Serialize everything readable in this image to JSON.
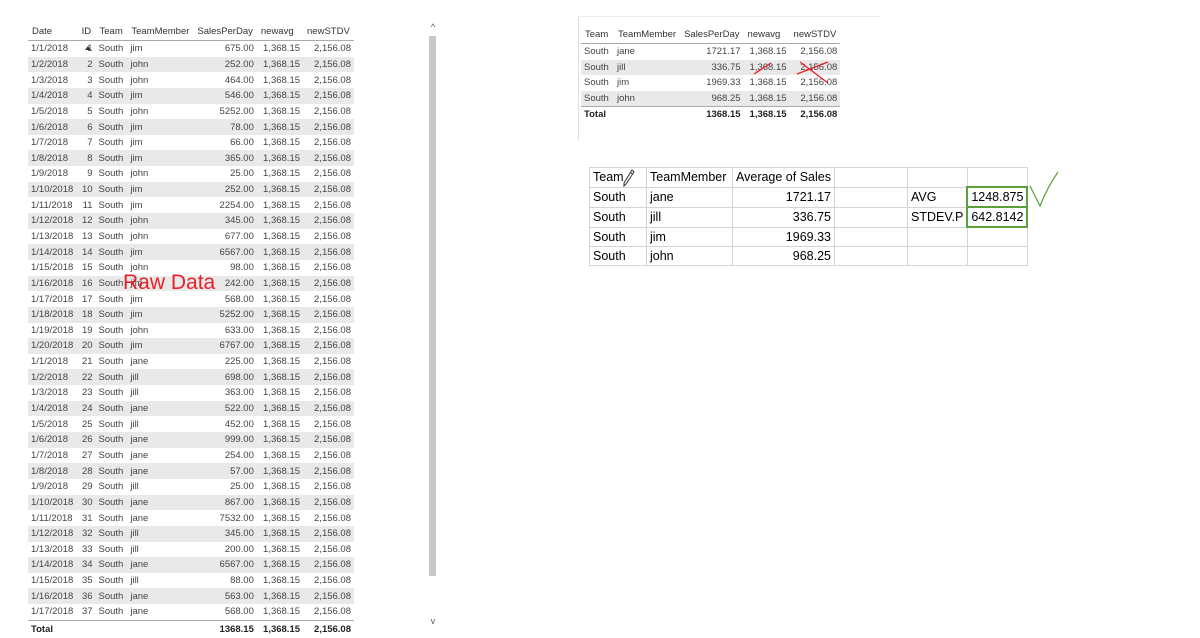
{
  "raw_table": {
    "headers": [
      "Date",
      "ID",
      "Team",
      "TeamMember",
      "SalesPerDay",
      "newavg",
      "newSTDV"
    ],
    "rows": [
      [
        "1/1/2018",
        "1",
        "South",
        "jim",
        "675.00",
        "1,368.15",
        "2,156.08"
      ],
      [
        "1/2/2018",
        "2",
        "South",
        "john",
        "252.00",
        "1,368.15",
        "2,156.08"
      ],
      [
        "1/3/2018",
        "3",
        "South",
        "john",
        "464.00",
        "1,368.15",
        "2,156.08"
      ],
      [
        "1/4/2018",
        "4",
        "South",
        "jim",
        "546.00",
        "1,368.15",
        "2,156.08"
      ],
      [
        "1/5/2018",
        "5",
        "South",
        "john",
        "5252.00",
        "1,368.15",
        "2,156.08"
      ],
      [
        "1/6/2018",
        "6",
        "South",
        "jim",
        "78.00",
        "1,368.15",
        "2,156.08"
      ],
      [
        "1/7/2018",
        "7",
        "South",
        "jim",
        "66.00",
        "1,368.15",
        "2,156.08"
      ],
      [
        "1/8/2018",
        "8",
        "South",
        "jim",
        "365.00",
        "1,368.15",
        "2,156.08"
      ],
      [
        "1/9/2018",
        "9",
        "South",
        "john",
        "25.00",
        "1,368.15",
        "2,156.08"
      ],
      [
        "1/10/2018",
        "10",
        "South",
        "jim",
        "252.00",
        "1,368.15",
        "2,156.08"
      ],
      [
        "1/11/2018",
        "11",
        "South",
        "jim",
        "2254.00",
        "1,368.15",
        "2,156.08"
      ],
      [
        "1/12/2018",
        "12",
        "South",
        "john",
        "345.00",
        "1,368.15",
        "2,156.08"
      ],
      [
        "1/13/2018",
        "13",
        "South",
        "john",
        "677.00",
        "1,368.15",
        "2,156.08"
      ],
      [
        "1/14/2018",
        "14",
        "South",
        "jim",
        "6567.00",
        "1,368.15",
        "2,156.08"
      ],
      [
        "1/15/2018",
        "15",
        "South",
        "john",
        "98.00",
        "1,368.15",
        "2,156.08"
      ],
      [
        "1/16/2018",
        "16",
        "South",
        "jim",
        "242.00",
        "1,368.15",
        "2,156.08"
      ],
      [
        "1/17/2018",
        "17",
        "South",
        "jim",
        "568.00",
        "1,368.15",
        "2,156.08"
      ],
      [
        "1/18/2018",
        "18",
        "South",
        "jim",
        "5252.00",
        "1,368.15",
        "2,156.08"
      ],
      [
        "1/19/2018",
        "19",
        "South",
        "john",
        "633.00",
        "1,368.15",
        "2,156.08"
      ],
      [
        "1/20/2018",
        "20",
        "South",
        "jim",
        "6767.00",
        "1,368.15",
        "2,156.08"
      ],
      [
        "1/1/2018",
        "21",
        "South",
        "jane",
        "225.00",
        "1,368.15",
        "2,156.08"
      ],
      [
        "1/2/2018",
        "22",
        "South",
        "jill",
        "698.00",
        "1,368.15",
        "2,156.08"
      ],
      [
        "1/3/2018",
        "23",
        "South",
        "jill",
        "363.00",
        "1,368.15",
        "2,156.08"
      ],
      [
        "1/4/2018",
        "24",
        "South",
        "jane",
        "522.00",
        "1,368.15",
        "2,156.08"
      ],
      [
        "1/5/2018",
        "25",
        "South",
        "jill",
        "452.00",
        "1,368.15",
        "2,156.08"
      ],
      [
        "1/6/2018",
        "26",
        "South",
        "jane",
        "999.00",
        "1,368.15",
        "2,156.08"
      ],
      [
        "1/7/2018",
        "27",
        "South",
        "jane",
        "254.00",
        "1,368.15",
        "2,156.08"
      ],
      [
        "1/8/2018",
        "28",
        "South",
        "jane",
        "57.00",
        "1,368.15",
        "2,156.08"
      ],
      [
        "1/9/2018",
        "29",
        "South",
        "jill",
        "25.00",
        "1,368.15",
        "2,156.08"
      ],
      [
        "1/10/2018",
        "30",
        "South",
        "jane",
        "867.00",
        "1,368.15",
        "2,156.08"
      ],
      [
        "1/11/2018",
        "31",
        "South",
        "jane",
        "7532.00",
        "1,368.15",
        "2,156.08"
      ],
      [
        "1/12/2018",
        "32",
        "South",
        "jill",
        "345.00",
        "1,368.15",
        "2,156.08"
      ],
      [
        "1/13/2018",
        "33",
        "South",
        "jill",
        "200.00",
        "1,368.15",
        "2,156.08"
      ],
      [
        "1/14/2018",
        "34",
        "South",
        "jane",
        "6567.00",
        "1,368.15",
        "2,156.08"
      ],
      [
        "1/15/2018",
        "35",
        "South",
        "jill",
        "88.00",
        "1,368.15",
        "2,156.08"
      ],
      [
        "1/16/2018",
        "36",
        "South",
        "jane",
        "563.00",
        "1,368.15",
        "2,156.08"
      ],
      [
        "1/17/2018",
        "37",
        "South",
        "jane",
        "568.00",
        "1,368.15",
        "2,156.08"
      ]
    ],
    "total": {
      "label": "Total",
      "sales": "1368.15",
      "avg": "1,368.15",
      "std": "2,156.08"
    },
    "overlay_label": "Raw Data",
    "overlay_color": "#e8202a"
  },
  "scrollbar": {
    "up_glyph": "^",
    "down_glyph": "v"
  },
  "summary_table": {
    "headers": [
      "Team",
      "TeamMember",
      "SalesPerDay",
      "newavg",
      "newSTDV"
    ],
    "rows": [
      [
        "South",
        "jane",
        "1721.17",
        "1,368.15",
        "2,156.08"
      ],
      [
        "South",
        "jill",
        "336.75",
        "1,368.15",
        "2,156.08"
      ],
      [
        "South",
        "jim",
        "1969.33",
        "1,368.15",
        "2,156.08"
      ],
      [
        "South",
        "john",
        "968.25",
        "1,368.15",
        "2,156.08"
      ]
    ],
    "total": {
      "label": "Total",
      "sales": "1368.15",
      "avg": "1,368.15",
      "std": "2,156.08"
    },
    "strike_color": "#e8202a"
  },
  "excel_grid": {
    "headers": [
      "Team",
      "TeamMember",
      "Average of Sales"
    ],
    "rows": [
      [
        "South",
        "jane",
        "1721.17"
      ],
      [
        "South",
        "jill",
        "336.75"
      ],
      [
        "South",
        "jim",
        "1969.33"
      ],
      [
        "South",
        "john",
        "968.25"
      ]
    ],
    "stats": [
      {
        "label": "AVG",
        "value": "1248.875"
      },
      {
        "label": "STDEV.P",
        "value": "642.8142"
      }
    ],
    "highlight_color": "#5aa03c"
  },
  "icons": {
    "pen": "pen-icon",
    "check": "checkmark-icon",
    "sort": "sort-ascending-icon"
  }
}
